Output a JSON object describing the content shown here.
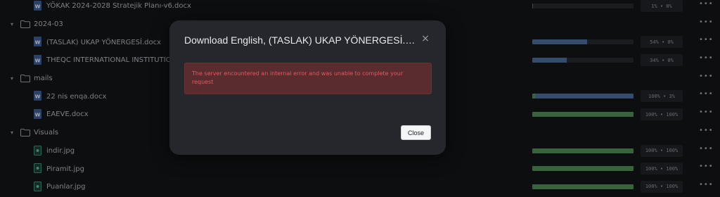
{
  "files": {
    "rows": [
      {
        "kind": "file",
        "ftype": "word",
        "name": "YÖKAK 2024-2028 Stratejik Planı-v6.docx",
        "progress": 0.01,
        "color": "blue",
        "status": "1% • 0%"
      },
      {
        "kind": "folder",
        "name": "2024-03"
      },
      {
        "kind": "file",
        "ftype": "word",
        "name": "(TASLAK) UKAP YÖNERGESİ.docx",
        "progress": 0.54,
        "color": "blue",
        "status": "54% • 0%"
      },
      {
        "kind": "file",
        "ftype": "word",
        "name": "THEQC INTERNATIONAL INSTITUTIONAL",
        "progress": 0.34,
        "color": "blue",
        "status": "34% • 0%"
      },
      {
        "kind": "folder",
        "name": "mails"
      },
      {
        "kind": "file",
        "ftype": "word",
        "name": "22 nis enqa.docx",
        "progress": 1.0,
        "color": "blue",
        "tip": 0.03,
        "status": "100% • 3%"
      },
      {
        "kind": "file",
        "ftype": "word",
        "name": "EAEVE.docx",
        "progress": 1.0,
        "color": "green",
        "status": "100% • 100%"
      },
      {
        "kind": "folder",
        "name": "Visuals"
      },
      {
        "kind": "file",
        "ftype": "image",
        "name": "indir.jpg",
        "progress": 1.0,
        "color": "green",
        "status": "100% • 100%"
      },
      {
        "kind": "file",
        "ftype": "image",
        "name": "Piramit.jpg",
        "progress": 1.0,
        "color": "green",
        "status": "100% • 100%"
      },
      {
        "kind": "file",
        "ftype": "image",
        "name": "Puanlar.jpg",
        "progress": 1.0,
        "color": "green",
        "status": "100% • 100%"
      }
    ],
    "more_label": "•••",
    "chevron": "▾"
  },
  "dialog": {
    "title": "Download English, (TASLAK) UKAP YÖNERGESİ.docx",
    "error_message": "The server encountered an internal error and was unable to complete your request",
    "close_icon": "×",
    "close_button_label": "Close"
  },
  "colors": {
    "progress_blue": "#4a6a96",
    "progress_green": "#4f8a55",
    "error_text": "#e05a5e",
    "error_bg": "#5a2c30"
  }
}
